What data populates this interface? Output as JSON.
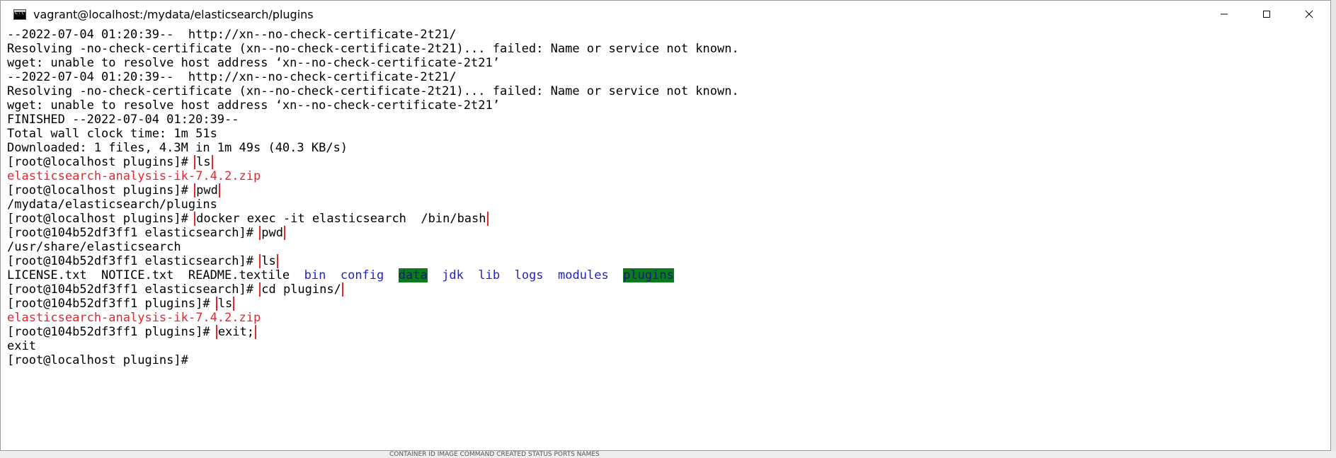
{
  "window": {
    "title": "vagrant@localhost:/mydata/elasticsearch/plugins"
  },
  "terminal": {
    "lines": [
      "--2022-07-04 01:20:39--  http://xn--no-check-certificate-2t21/",
      "Resolving -no-check-certificate (xn--no-check-certificate-2t21)... failed: Name or service not known.",
      "wget: unable to resolve host address ‘xn--no-check-certificate-2t21’",
      "--2022-07-04 01:20:39--  http://xn--no-check-certificate-2t21/",
      "Resolving -no-check-certificate (xn--no-check-certificate-2t21)... failed: Name or service not known.",
      "wget: unable to resolve host address ‘xn--no-check-certificate-2t21’",
      "FINISHED --2022-07-04 01:20:39--",
      "Total wall clock time: 1m 51s",
      "Downloaded: 1 files, 4.3M in 1m 49s (40.3 KB/s)"
    ],
    "prompts": {
      "host_plugins": "[root@localhost plugins]# ",
      "container_es": "[root@104b52df3ff1 elasticsearch]# ",
      "container_plugins": "[root@104b52df3ff1 plugins]# ",
      "final": "[root@localhost plugins]#"
    },
    "commands": {
      "ls1": "ls",
      "pwd1": "pwd",
      "docker": "docker exec -it elasticsearch  /bin/bash",
      "pwd2": "pwd",
      "ls2": "ls",
      "cd": "cd plugins/",
      "ls3": "ls",
      "exit": "exit;"
    },
    "outputs": {
      "zip1": "elasticsearch-analysis-ik-7.4.2.zip",
      "path1": "/mydata/elasticsearch/plugins",
      "path2": "/usr/share/elasticsearch",
      "zip2": "elasticsearch-analysis-ik-7.4.2.zip",
      "exit_echo": "exit"
    },
    "ls_listing": {
      "files": "LICENSE.txt  NOTICE.txt  README.textile  ",
      "bin": "bin",
      "config": "config",
      "data": "data",
      "jdk": "jdk",
      "lib": "lib",
      "logs": "logs",
      "modules": "modules",
      "plugins": "plugins"
    }
  },
  "background": {
    "strip_text": "CONTAINER ID   IMAGE          COMMAND          CREATED      STATUS      PORTS      NAMES"
  },
  "colors": {
    "highlight_box": "#e0282f",
    "zip_output": "#e0282f",
    "dir_blue": "#2222cc",
    "dir_highlight_bg": "#0a7a1a"
  }
}
